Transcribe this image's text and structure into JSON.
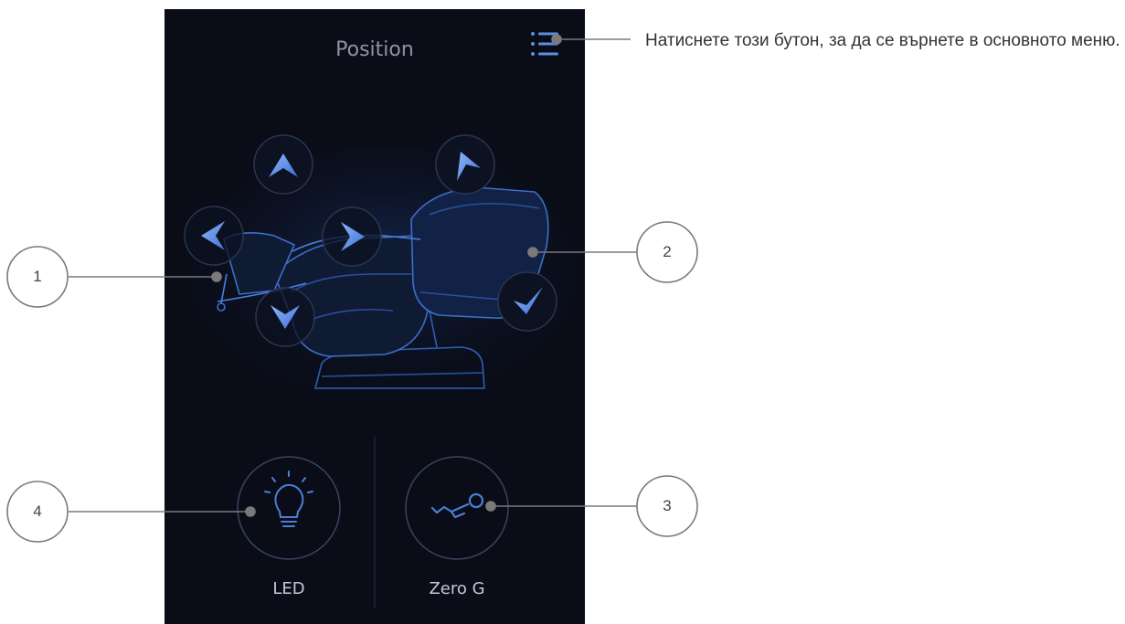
{
  "screen": {
    "title": "Position",
    "menu_icon": "list-menu-icon"
  },
  "controls": {
    "up": "chevron-up-icon",
    "left": "chevron-left-icon",
    "right": "chevron-right-icon",
    "down": "chevron-down-icon",
    "recline_up": "chevron-up-right-icon",
    "recline_down": "chevron-down-right-icon"
  },
  "buttons": {
    "led": {
      "label": "LED",
      "icon": "light-bulb-icon"
    },
    "zero_g": {
      "label": "Zero G",
      "icon": "zero-gravity-icon"
    }
  },
  "annotations": {
    "menu_instruction": "Натиснете този бутон, за да се върнете в основното меню.",
    "callouts": [
      "1",
      "2",
      "3",
      "4"
    ]
  },
  "colors": {
    "panel_bg": "#0a0d18",
    "accent": "#4a7fd4",
    "chair_outline": "#3d6ec8",
    "callout_line": "#7a7a7a"
  }
}
